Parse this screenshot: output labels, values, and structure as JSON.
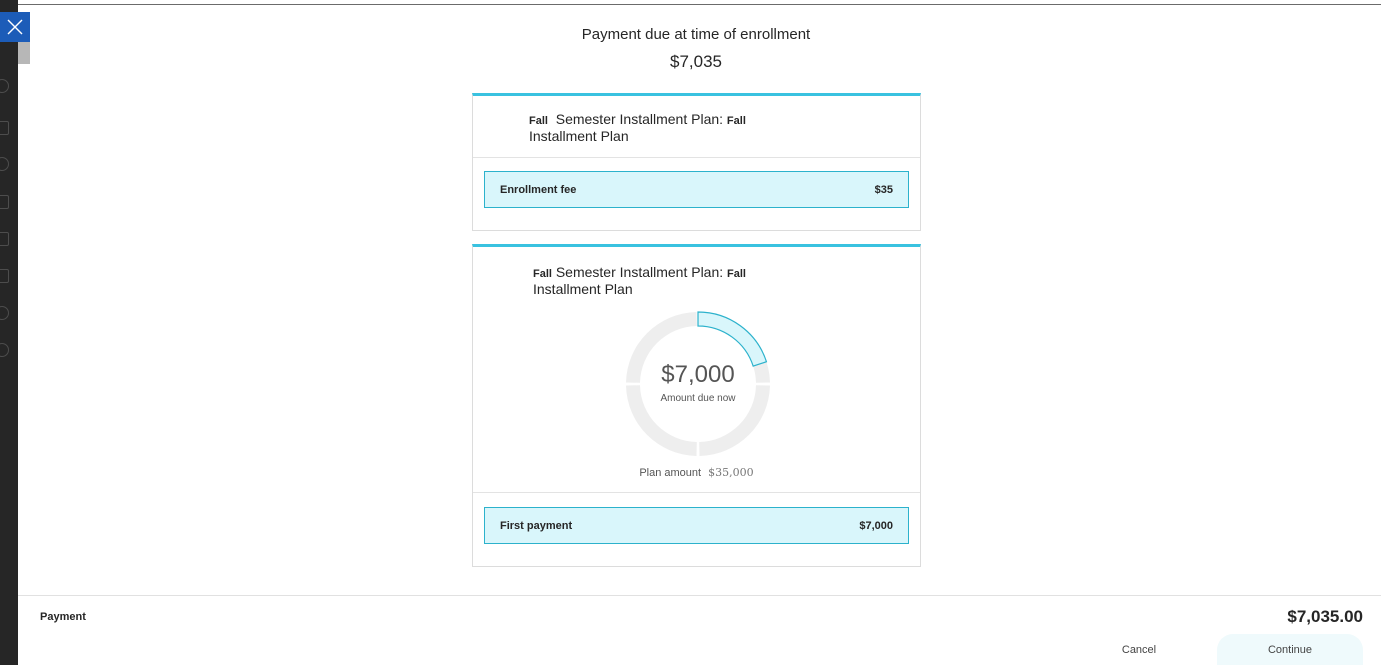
{
  "header": {
    "title": "Payment due at time of enrollment",
    "amount": "$7,035"
  },
  "enrollment_card": {
    "title_term": "Fall",
    "title_mid": "Semester Installment Plan:",
    "title_term2": "Fall",
    "title_rest": "Installment Plan",
    "line_item_label": "Enrollment fee",
    "line_item_amount": "$35"
  },
  "plan_card": {
    "title_term": "Fall",
    "title_mid": "Semester Installment Plan:",
    "title_term2": "Fall",
    "title_rest": "Installment Plan",
    "donut_amount": "$7,000",
    "donut_label": "Amount due now",
    "donut_fraction": 0.2,
    "plan_amount_label": "Plan amount",
    "plan_amount_value": "$35,000",
    "line_item_label": "First payment",
    "line_item_amount": "$7,000"
  },
  "footer": {
    "label": "Payment",
    "total": "$7,035.00",
    "cancel_label": "Cancel",
    "continue_label": "Continue"
  },
  "colors": {
    "accent": "#39c2e0",
    "highlight_fill": "#d9f6fb",
    "close_button": "#1c5cb8"
  }
}
